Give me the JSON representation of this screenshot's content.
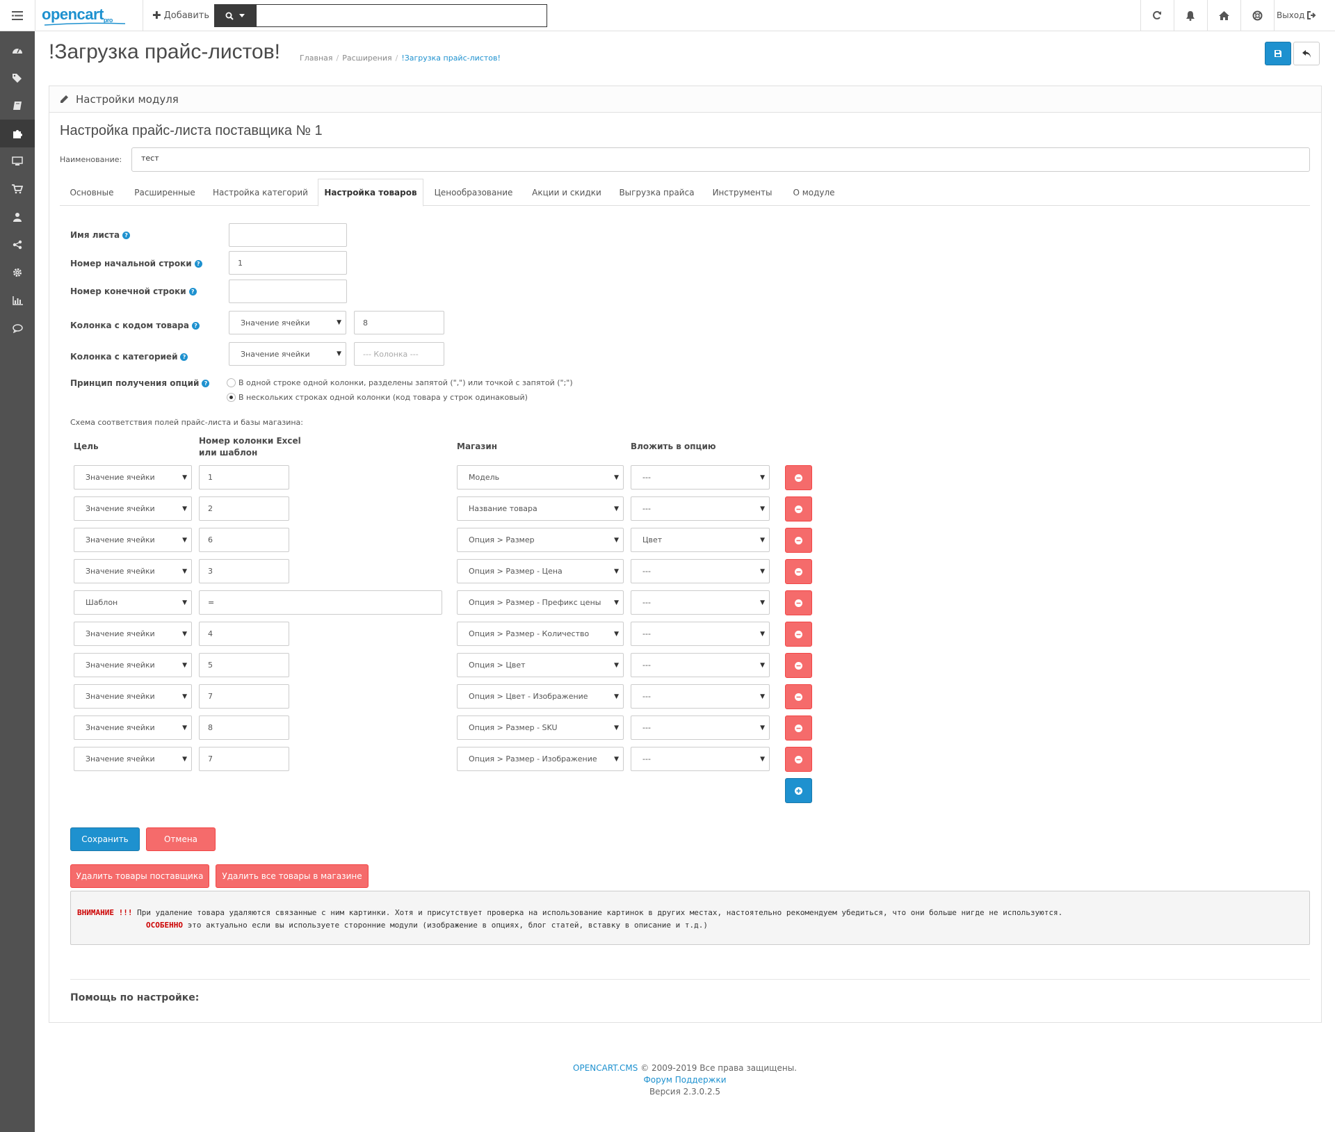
{
  "header": {
    "logo_text": "opencart",
    "logo_sub": "pro",
    "add_label": "Добавить",
    "search_placeholder": "",
    "logout_label": "Выход"
  },
  "page": {
    "title": "!Загрузка прайс-листов!",
    "breadcrumb": [
      "Главная",
      "Расширения",
      "!Загрузка прайс-листов!"
    ]
  },
  "panel": {
    "heading": "Настройки модуля",
    "subtitle": "Настройка прайс-листа поставщика № 1",
    "name_label": "Наименование:",
    "name_value": "тест"
  },
  "tabs": [
    "Основные",
    "Расширенные",
    "Настройка категорий",
    "Настройка товаров",
    "Ценообразование",
    "Акции и скидки",
    "Выгрузка прайса",
    "Инструменты",
    "О модуле"
  ],
  "active_tab": "Настройка товаров",
  "form": {
    "sheet_name_label": "Имя листа",
    "sheet_name_value": "",
    "start_row_label": "Номер начальной строки",
    "start_row_value": "1",
    "end_row_label": "Номер конечной строки",
    "end_row_value": "",
    "code_col_label": "Колонка с кодом товара",
    "code_col_select": "Значение ячейки",
    "code_col_value": "8",
    "cat_col_label": "Колонка с категорией",
    "cat_col_select": "Значение ячейки",
    "cat_col_placeholder": "--- Колонка ---",
    "options_label": "Принцип получения опций",
    "option_1": "В одной строке одной колонки, разделены запятой (\",\") или точкой с запятой (\";\")",
    "option_2": "В нескольких строках одной колонки (код товара у строк одинаковый)",
    "selected_option": 2
  },
  "schema": {
    "label": "Схема соответствия полей прайс-листа и базы магазина:",
    "col_target": "Цель",
    "col_excel_1": "Номер колонки Excel",
    "col_excel_2": "или шаблон",
    "col_store": "Магазин",
    "col_option": "Вложить в опцию",
    "rows": [
      {
        "target": "Значение ячейки",
        "value": "1",
        "store": "Модель",
        "option": "---"
      },
      {
        "target": "Значение ячейки",
        "value": "2",
        "store": "Название товара",
        "option": "---"
      },
      {
        "target": "Значение ячейки",
        "value": "6",
        "store": "Опция > Размер",
        "option": "Цвет"
      },
      {
        "target": "Значение ячейки",
        "value": "3",
        "store": "Опция > Размер - Цена",
        "option": "---"
      },
      {
        "target": "Шаблон",
        "value": "=",
        "store": "Опция > Размер - Префикс цены",
        "option": "---"
      },
      {
        "target": "Значение ячейки",
        "value": "4",
        "store": "Опция > Размер - Количество",
        "option": "---"
      },
      {
        "target": "Значение ячейки",
        "value": "5",
        "store": "Опция > Цвет",
        "option": "---"
      },
      {
        "target": "Значение ячейки",
        "value": "7",
        "store": "Опция > Цвет - Изображение",
        "option": "---"
      },
      {
        "target": "Значение ячейки",
        "value": "8",
        "store": "Опция > Размер - SKU",
        "option": "---"
      },
      {
        "target": "Значение ячейки",
        "value": "7",
        "store": "Опция > Размер - Изображение",
        "option": "---"
      }
    ]
  },
  "buttons": {
    "save": "Сохранить",
    "cancel": "Отмена",
    "delete_supplier": "Удалить товары поставщика",
    "delete_all": "Удалить все товары в магазине"
  },
  "warning": {
    "attention": "ВНИМАНИЕ !!!",
    "line1": " При удаление товара удаляются связанные с ним картинки. Хотя и присутствует проверка на использование картинок в других местах, настоятельно рекомендуем убедиться, что они больше нигде не используются.",
    "especially": "ОСОБЕННО",
    "line2": " это актуально если вы используете сторонние модули (изображение в опциях, блог статей, вставку в описание и т.д.)"
  },
  "help_title": "Помощь по настройке:",
  "footer": {
    "brand": "OPENCART.CMS",
    "copyright": " © 2009-2019 Все права защищены.",
    "forum": "Форум Поддержки",
    "version": "Версия 2.3.0.2.5"
  },
  "colors": {
    "primary": "#1e91cf",
    "danger": "#f56b6b",
    "sidebar": "#515151"
  }
}
